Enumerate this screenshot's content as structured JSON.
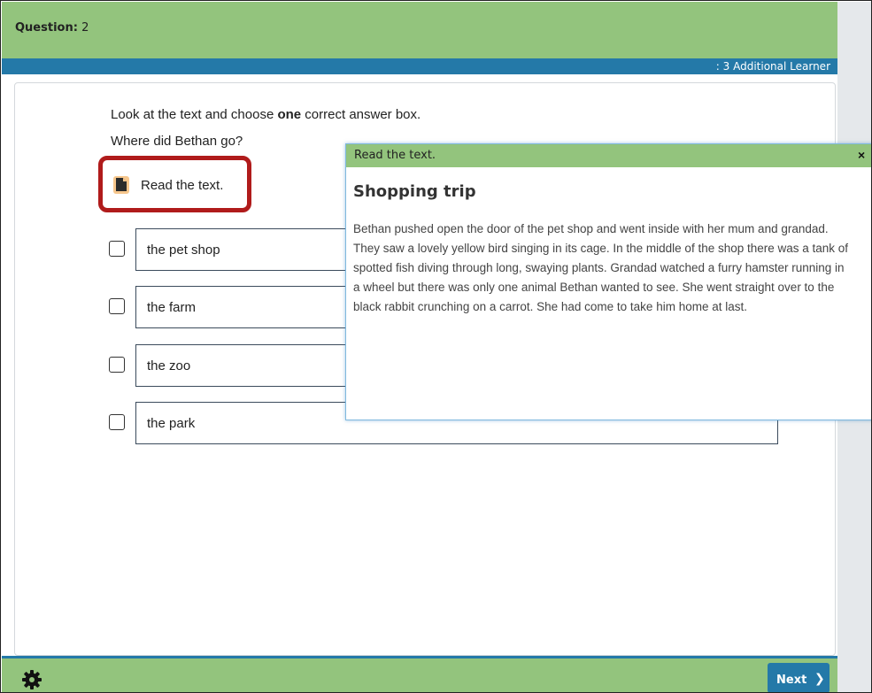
{
  "header": {
    "question_label": "Question:",
    "question_number": "2",
    "subbar_text": ": 3 Additional Learner"
  },
  "task": {
    "instruction_pre": "Look at the text and choose ",
    "instruction_bold": "one",
    "instruction_post": " correct answer box.",
    "question": "Where did Bethan go?",
    "read_button_label": "Read the text."
  },
  "options": [
    {
      "label": "the pet shop",
      "checked": false
    },
    {
      "label": "the farm",
      "checked": false
    },
    {
      "label": "the zoo",
      "checked": false
    },
    {
      "label": "the park",
      "checked": false
    }
  ],
  "popup": {
    "title": "Read the text.",
    "close_glyph": "×",
    "heading": "Shopping trip",
    "body": "Bethan pushed open the door of the pet shop and went inside with her mum and grandad. They saw a lovely yellow bird singing in its cage. In the middle of the shop there was a tank of spotted fish diving through long, swaying plants. Grandad watched a furry hamster running in a wheel but there was only one animal Bethan wanted to see. She went straight over to the black rabbit crunching on a carrot. She had come to take him home at last."
  },
  "footer": {
    "next_label": "Next",
    "next_chevron": "❯",
    "settings_icon": "gear-icon"
  },
  "colors": {
    "green_bar": "#93c47d",
    "blue_bar": "#2479a8",
    "highlight_red": "#b01b1b"
  }
}
